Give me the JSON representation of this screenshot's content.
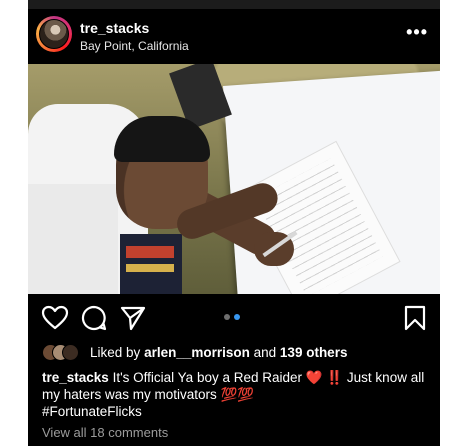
{
  "post": {
    "username": "tre_stacks",
    "location": "Bay Point, California",
    "more_label": "•••"
  },
  "actions": {
    "like_icon": "heart-outline-icon",
    "comment_icon": "comment-bubble-icon",
    "share_icon": "paper-plane-icon",
    "save_icon": "bookmark-icon"
  },
  "carousel": {
    "count": 2,
    "active": 2,
    "active_color": "#3897f0",
    "inactive_color": "#6e6e6e"
  },
  "likes": {
    "prefix": "Liked by",
    "user": "arlen__morrison",
    "and": "and",
    "others": "139 others"
  },
  "caption": {
    "author": "tre_stacks",
    "text": "It's Official Ya boy a Red Raider",
    "heart": "❤️",
    "bang": "‼️",
    "text2": "Just know all my haters was my motivators",
    "hundreds": "💯💯",
    "hashtag": "#FortunateFlicks"
  },
  "comments": {
    "label": "View all 18 comments"
  },
  "colors": {
    "background": "#000000",
    "text": "#ffffff",
    "muted": "#9c9c9c"
  }
}
